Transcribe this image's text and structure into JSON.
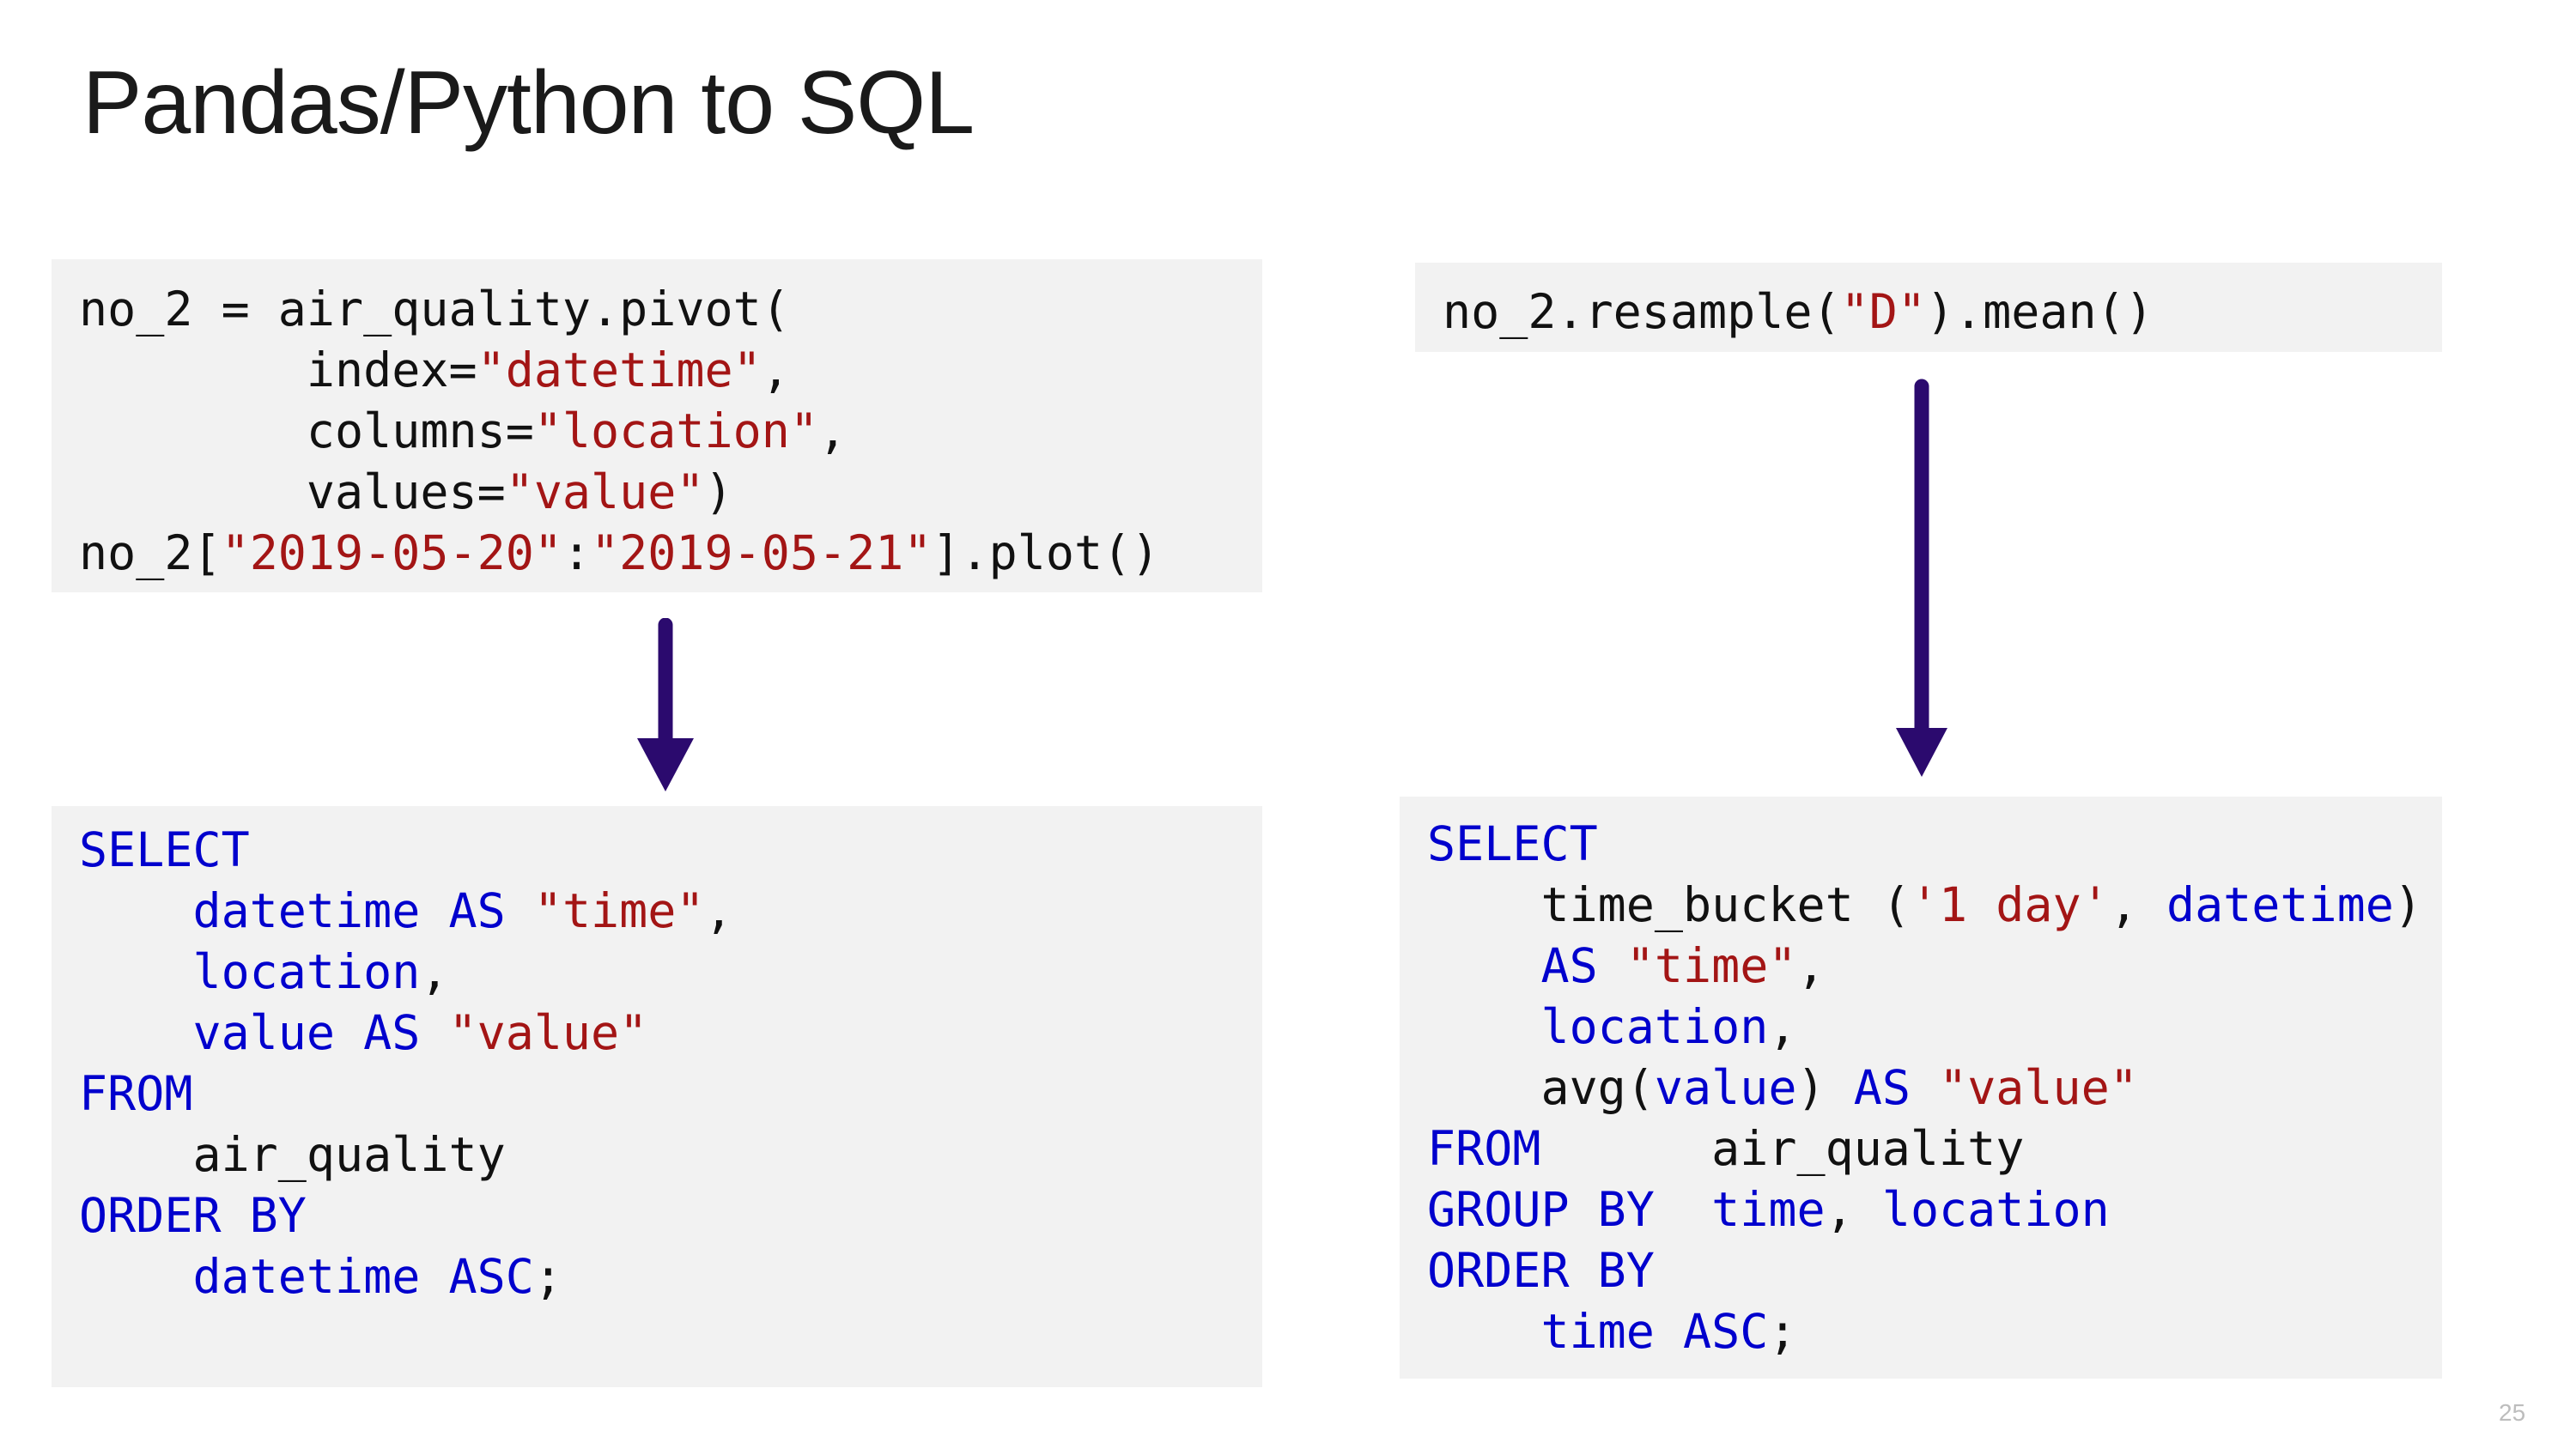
{
  "slide": {
    "title": "Pandas/Python to SQL",
    "page_number": "25"
  },
  "left_pandas": {
    "lines": [
      [
        {
          "t": "no_2 = air_quality.pivot("
        }
      ],
      [
        {
          "t": "        index="
        },
        {
          "t": "\"datetime\"",
          "c": "s"
        },
        {
          "t": ","
        }
      ],
      [
        {
          "t": "        columns="
        },
        {
          "t": "\"location\"",
          "c": "s"
        },
        {
          "t": ","
        }
      ],
      [
        {
          "t": "        values="
        },
        {
          "t": "\"value\"",
          "c": "s"
        },
        {
          "t": ")"
        }
      ],
      [
        {
          "t": "no_2["
        },
        {
          "t": "\"2019-05-20\"",
          "c": "s"
        },
        {
          "t": ":"
        },
        {
          "t": "\"2019-05-21\"",
          "c": "s"
        },
        {
          "t": "].plot()"
        }
      ]
    ]
  },
  "left_sql": {
    "lines": [
      [
        {
          "t": "SELECT",
          "c": "k"
        }
      ],
      [
        {
          "t": "    "
        },
        {
          "t": "datetime AS",
          "c": "k"
        },
        {
          "t": " "
        },
        {
          "t": "\"time\"",
          "c": "s"
        },
        {
          "t": ","
        }
      ],
      [
        {
          "t": "    "
        },
        {
          "t": "location",
          "c": "k"
        },
        {
          "t": ","
        }
      ],
      [
        {
          "t": "    "
        },
        {
          "t": "value AS",
          "c": "k"
        },
        {
          "t": " "
        },
        {
          "t": "\"value\"",
          "c": "s"
        }
      ],
      [
        {
          "t": "FROM",
          "c": "k"
        }
      ],
      [
        {
          "t": "    air_quality"
        }
      ],
      [
        {
          "t": "ORDER BY",
          "c": "k"
        }
      ],
      [
        {
          "t": "    "
        },
        {
          "t": "datetime ASC",
          "c": "k"
        },
        {
          "t": ";"
        }
      ]
    ]
  },
  "right_pandas": {
    "lines": [
      [
        {
          "t": "no_2.resample("
        },
        {
          "t": "\"D\"",
          "c": "s"
        },
        {
          "t": ").mean()"
        }
      ]
    ]
  },
  "right_sql": {
    "lines": [
      [
        {
          "t": "SELECT",
          "c": "k"
        }
      ],
      [
        {
          "t": "    time_bucket ("
        },
        {
          "t": "'1 day'",
          "c": "s"
        },
        {
          "t": ", "
        },
        {
          "t": "datetime",
          "c": "k"
        },
        {
          "t": ")"
        }
      ],
      [
        {
          "t": "    "
        },
        {
          "t": "AS",
          "c": "k"
        },
        {
          "t": " "
        },
        {
          "t": "\"time\"",
          "c": "s"
        },
        {
          "t": ","
        }
      ],
      [
        {
          "t": "    "
        },
        {
          "t": "location",
          "c": "k"
        },
        {
          "t": ","
        }
      ],
      [
        {
          "t": "    avg("
        },
        {
          "t": "value",
          "c": "k"
        },
        {
          "t": ") "
        },
        {
          "t": "AS",
          "c": "k"
        },
        {
          "t": " "
        },
        {
          "t": "\"value\"",
          "c": "s"
        }
      ],
      [
        {
          "t": "FROM",
          "c": "k"
        },
        {
          "t": "      air_quality"
        }
      ],
      [
        {
          "t": "GROUP BY",
          "c": "k"
        },
        {
          "t": "  "
        },
        {
          "t": "time",
          "c": "k"
        },
        {
          "t": ", "
        },
        {
          "t": "location",
          "c": "k"
        }
      ],
      [
        {
          "t": "ORDER BY",
          "c": "k"
        }
      ],
      [
        {
          "t": "    "
        },
        {
          "t": "time ASC",
          "c": "k"
        },
        {
          "t": ";"
        }
      ]
    ]
  },
  "colors": {
    "string": "#a31515",
    "keyword": "#0000cd",
    "arrow": "#2b0a6e",
    "code_background": "#f2f2f2"
  },
  "icons": [
    "arrow-down-icon",
    "arrow-down-icon"
  ]
}
